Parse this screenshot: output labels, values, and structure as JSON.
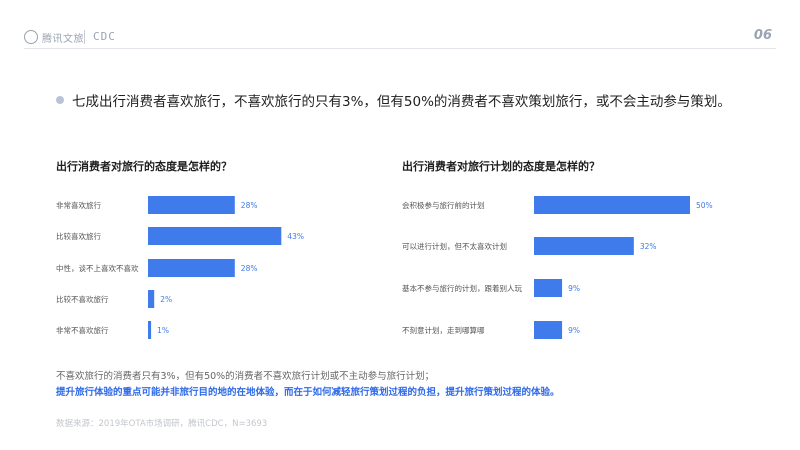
{
  "header": {
    "logo_text": "腾讯文旅",
    "logo2_text": "CDC",
    "page_number": "06"
  },
  "headline": "七成出行消费者喜欢旅行，不喜欢旅行的只有3%，但有50%的消费者不喜欢策划旅行，或不会主动参与策划。",
  "notes": {
    "line1": "不喜欢旅行的消费者只有3%，但有50%的消费者不喜欢旅行计划或不主动参与旅行计划；",
    "line2": "提升旅行体验的重点可能并非旅行目的地的在地体验，而在于如何减轻旅行策划过程的负担，提升旅行策划过程的体验。"
  },
  "source": "数据来源：2019年OTA市场调研，腾讯CDC，N=3693",
  "colors": {
    "bar": "#3f7bea",
    "label": "#3f7bea",
    "category": "#555555"
  },
  "chart_data": [
    {
      "type": "bar",
      "orientation": "horizontal",
      "title": "出行消费者对旅行的态度是怎样的？",
      "categories": [
        "非常喜欢旅行",
        "比较喜欢旅行",
        "中性，谈不上喜欢不喜欢",
        "比较不喜欢旅行",
        "非常不喜欢旅行"
      ],
      "values": [
        28,
        43,
        28,
        2,
        1
      ],
      "value_labels": [
        "28%",
        "43%",
        "28%",
        "2%",
        "1%"
      ],
      "unit": "%",
      "xlim": [
        0,
        50
      ],
      "grid": false
    },
    {
      "type": "bar",
      "orientation": "horizontal",
      "title": "出行消费者对旅行计划的态度是怎样的？",
      "categories": [
        "会积极参与旅行前的计划",
        "可以进行计划，但不太喜欢计划",
        "基本不参与旅行的计划，跟着别人玩",
        "不刻意计划，走到哪算哪"
      ],
      "values": [
        50,
        32,
        9,
        9
      ],
      "value_labels": [
        "50%",
        "32%",
        "9%",
        "9%"
      ],
      "unit": "%",
      "xlim": [
        0,
        50
      ],
      "grid": false
    }
  ]
}
